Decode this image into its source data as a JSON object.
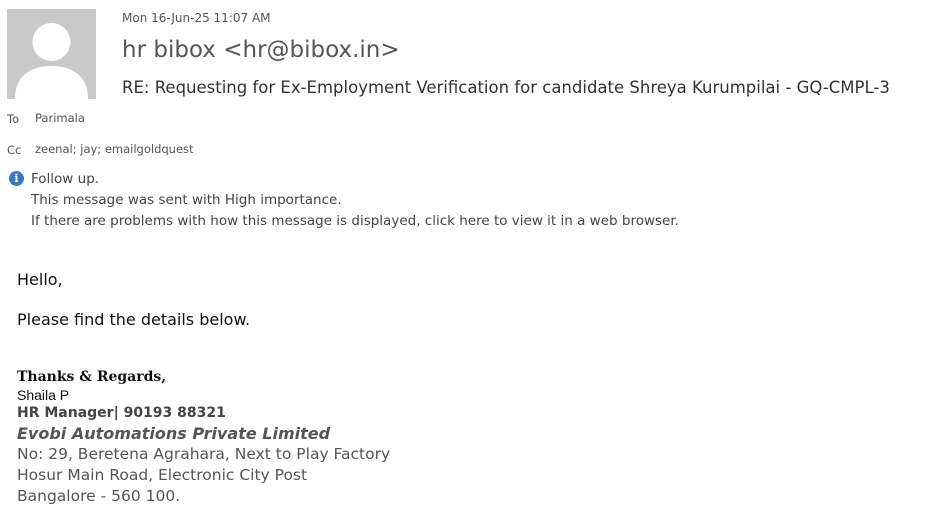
{
  "message": {
    "date": "Mon 16-Jun-25 11:07 AM",
    "sender": "hr bibox <hr@bibox.in>",
    "subject": "RE: Requesting for Ex-Employment Verification for candidate Shreya Kurumpilai - GQ-CMPL-3"
  },
  "recipients": {
    "to_label": "To",
    "to_value": "Parimala",
    "cc_label": "Cc",
    "cc_value": "zeenal; jay; emailgoldquest"
  },
  "info_bar": {
    "icon": "info-icon",
    "follow_up": "Follow up.",
    "importance": "This message was sent with High importance.",
    "display_notice": "If there are problems with how this message is displayed, click here to view it in a web browser."
  },
  "body": {
    "greeting": "Hello,",
    "line1": "Please find the details below."
  },
  "signature": {
    "closing": "Thanks & Regards,",
    "name": "Shaila P",
    "title": "HR Manager| 90193 88321",
    "company": "Evobi Automations Private Limited",
    "address1": "No: 29, Beretena Agrahara, Next to Play Factory",
    "address2": "Hosur Main Road, Electronic City Post",
    "address3": "Bangalore - 560 100."
  },
  "colors": {
    "avatar_bg": "#c9c9c9",
    "info_icon": "#3b78c2"
  }
}
